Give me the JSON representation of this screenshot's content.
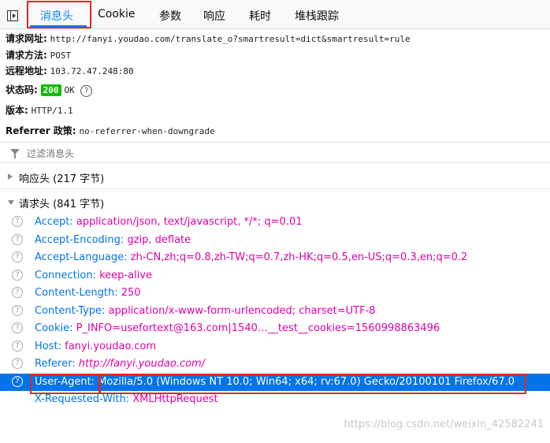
{
  "tabs": [
    {
      "label": "消息头",
      "active": true
    },
    {
      "label": "Cookie"
    },
    {
      "label": "参数"
    },
    {
      "label": "响应"
    },
    {
      "label": "耗时"
    },
    {
      "label": "堆栈跟踪"
    }
  ],
  "summary": {
    "url_label": "请求网址:",
    "url": "http://fanyi.youdao.com/translate_o?smartresult=dict&smartresult=rule",
    "method_label": "请求方法:",
    "method": "POST",
    "remote_label": "远程地址:",
    "remote": "103.72.47.248:80",
    "status_label": "状态码:",
    "status_code": "200",
    "status_text": "OK",
    "version_label": "版本:",
    "version": "HTTP/1.1",
    "referrer_policy_label": "Referrer 政策:",
    "referrer_policy": "no-referrer-when-downgrade"
  },
  "filter": {
    "placeholder": "过滤消息头"
  },
  "sections": {
    "response": "响应头 (217 字节)",
    "request": "请求头 (841 字节)"
  },
  "request_headers": [
    {
      "key": "Accept:",
      "value": "application/json, text/javascript, */*; q=0.01"
    },
    {
      "key": "Accept-Encoding:",
      "value": "gzip, deflate"
    },
    {
      "key": "Accept-Language:",
      "value": "zh-CN,zh;q=0.8,zh-TW;q=0.7,zh-HK;q=0.5,en-US;q=0.3,en;q=0.2"
    },
    {
      "key": "Connection:",
      "value": "keep-alive"
    },
    {
      "key": "Content-Length:",
      "value": "250"
    },
    {
      "key": "Content-Type:",
      "value": "application/x-www-form-urlencoded; charset=UTF-8"
    },
    {
      "key": "Cookie:",
      "value": "P_INFO=usefortext@163.com|1540…__test__cookies=1560998863496"
    },
    {
      "key": "Host:",
      "value": "fanyi.youdao.com"
    },
    {
      "key": "Referer:",
      "value": "http://fanyi.youdao.com/"
    },
    {
      "key": "User-Agent:",
      "value": "Mozilla/5.0 (Windows NT 10.0; Win64; x64; rv:67.0) Gecko/20100101 Firefox/67.0",
      "selected": true
    },
    {
      "key": "X-Requested-With:",
      "value": "XMLHttpRequest"
    }
  ],
  "help_glyph": "?",
  "watermark": "https://blog.csdn.net/weixin_42582241",
  "colors": {
    "accent": "#0a84ff",
    "key": "#0074e8",
    "value": "#dd00a9",
    "status": "#12bc00",
    "highlight_box": "#e5242a"
  }
}
